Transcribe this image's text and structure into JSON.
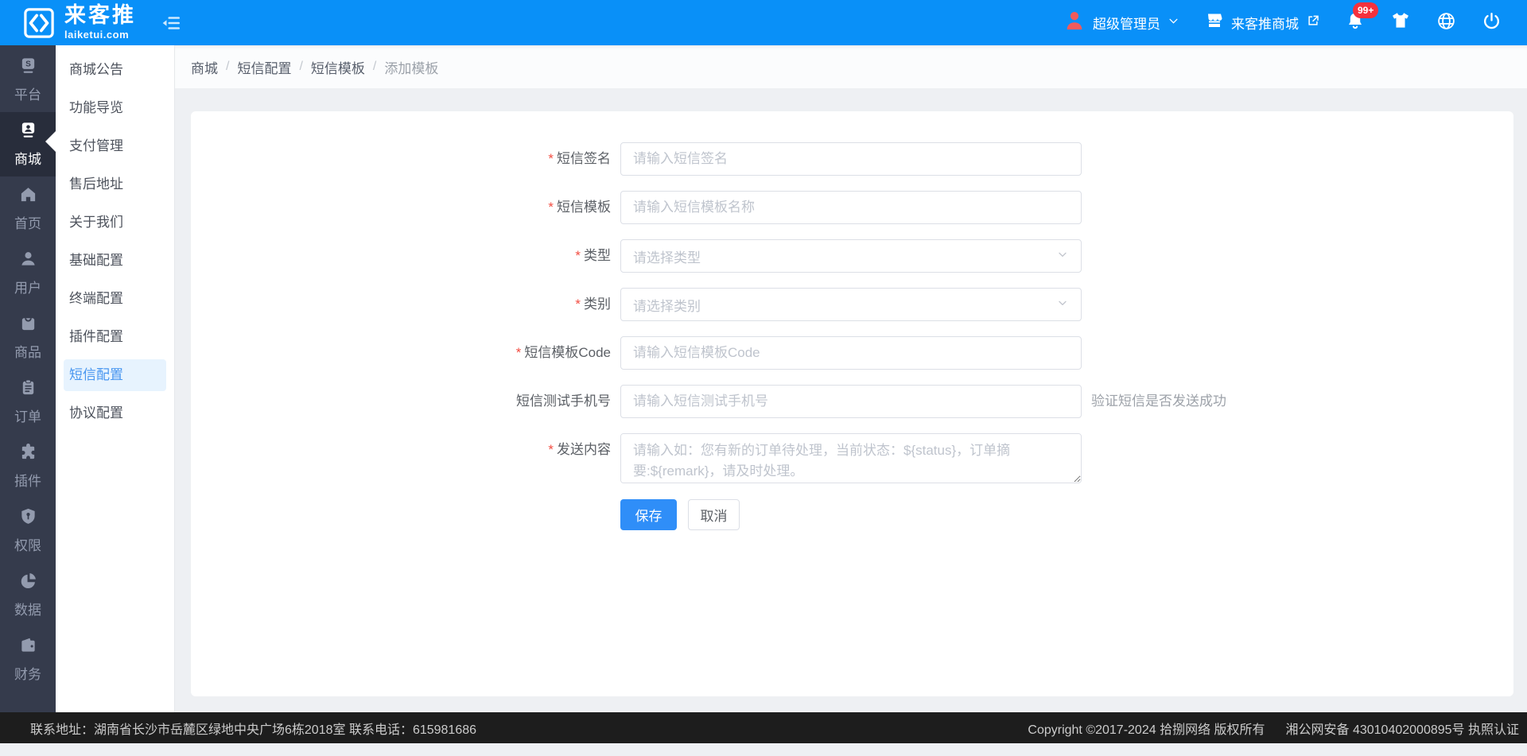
{
  "header": {
    "logo": {
      "title": "来客推",
      "subtitle": "laiketui.com"
    },
    "user": {
      "name": "超级管理员"
    },
    "shop_link": {
      "label": "来客推商城"
    },
    "notifications_badge": "99+"
  },
  "sidebar": {
    "items": [
      {
        "label": "平台",
        "icon": "platform-icon",
        "active": false
      },
      {
        "label": "商城",
        "icon": "mall-icon",
        "active": true
      },
      {
        "label": "首页",
        "icon": "home-icon",
        "active": false
      },
      {
        "label": "用户",
        "icon": "user-icon",
        "active": false
      },
      {
        "label": "商品",
        "icon": "goods-icon",
        "active": false
      },
      {
        "label": "订单",
        "icon": "order-icon",
        "active": false
      },
      {
        "label": "插件",
        "icon": "plugin-icon",
        "active": false
      },
      {
        "label": "权限",
        "icon": "permission-icon",
        "active": false
      },
      {
        "label": "数据",
        "icon": "data-icon",
        "active": false
      },
      {
        "label": "财务",
        "icon": "finance-icon",
        "active": false
      },
      {
        "label": "",
        "icon": "image-icon",
        "active": false
      }
    ]
  },
  "submenu": {
    "items": [
      {
        "label": "商城公告",
        "active": false
      },
      {
        "label": "功能导览",
        "active": false
      },
      {
        "label": "支付管理",
        "active": false
      },
      {
        "label": "售后地址",
        "active": false
      },
      {
        "label": "关于我们",
        "active": false
      },
      {
        "label": "基础配置",
        "active": false
      },
      {
        "label": "终端配置",
        "active": false
      },
      {
        "label": "插件配置",
        "active": false
      },
      {
        "label": "短信配置",
        "active": true
      },
      {
        "label": "协议配置",
        "active": false
      }
    ]
  },
  "breadcrumb": {
    "separator": "/",
    "items": [
      "商城",
      "短信配置",
      "短信模板",
      "添加模板"
    ]
  },
  "form": {
    "required_mark": "*",
    "fields": [
      {
        "label": "短信签名",
        "required": true,
        "type": "input",
        "placeholder": "请输入短信签名"
      },
      {
        "label": "短信模板",
        "required": true,
        "type": "input",
        "placeholder": "请输入短信模板名称"
      },
      {
        "label": "类型",
        "required": true,
        "type": "select",
        "placeholder": "请选择类型"
      },
      {
        "label": "类别",
        "required": true,
        "type": "select",
        "placeholder": "请选择类别"
      },
      {
        "label": "短信模板Code",
        "required": true,
        "type": "input",
        "placeholder": "请输入短信模板Code"
      },
      {
        "label": "短信测试手机号",
        "required": false,
        "type": "input",
        "placeholder": "请输入短信测试手机号",
        "hint": "验证短信是否发送成功"
      },
      {
        "label": "发送内容",
        "required": true,
        "type": "textarea",
        "placeholder": "请输入如：您有新的订单待处理，当前状态：${status}，订单摘要:${remark}，请及时处理。"
      }
    ],
    "save_label": "保存",
    "cancel_label": "取消"
  },
  "footer": {
    "contact": "联系地址：湖南省长沙市岳麓区绿地中央广场6栋2018室 联系电话：615981686",
    "copyright": "Copyright ©2017-2024 拾捌网络 版权所有",
    "police": "湘公网安备 43010402000895号 执照认证"
  },
  "colors": {
    "header_blue": "#0990f8",
    "sidebar_dark": "#353b4c",
    "sidebar_active_bg": "#282d3b",
    "submenu_active_bg": "#e7f3fe",
    "submenu_active_text": "#4896f0",
    "primary_button": "#2f8ef8",
    "badge_red": "#f5313d",
    "avatar_red": "#f15b5c",
    "footer_bg": "#1d1d1d"
  }
}
